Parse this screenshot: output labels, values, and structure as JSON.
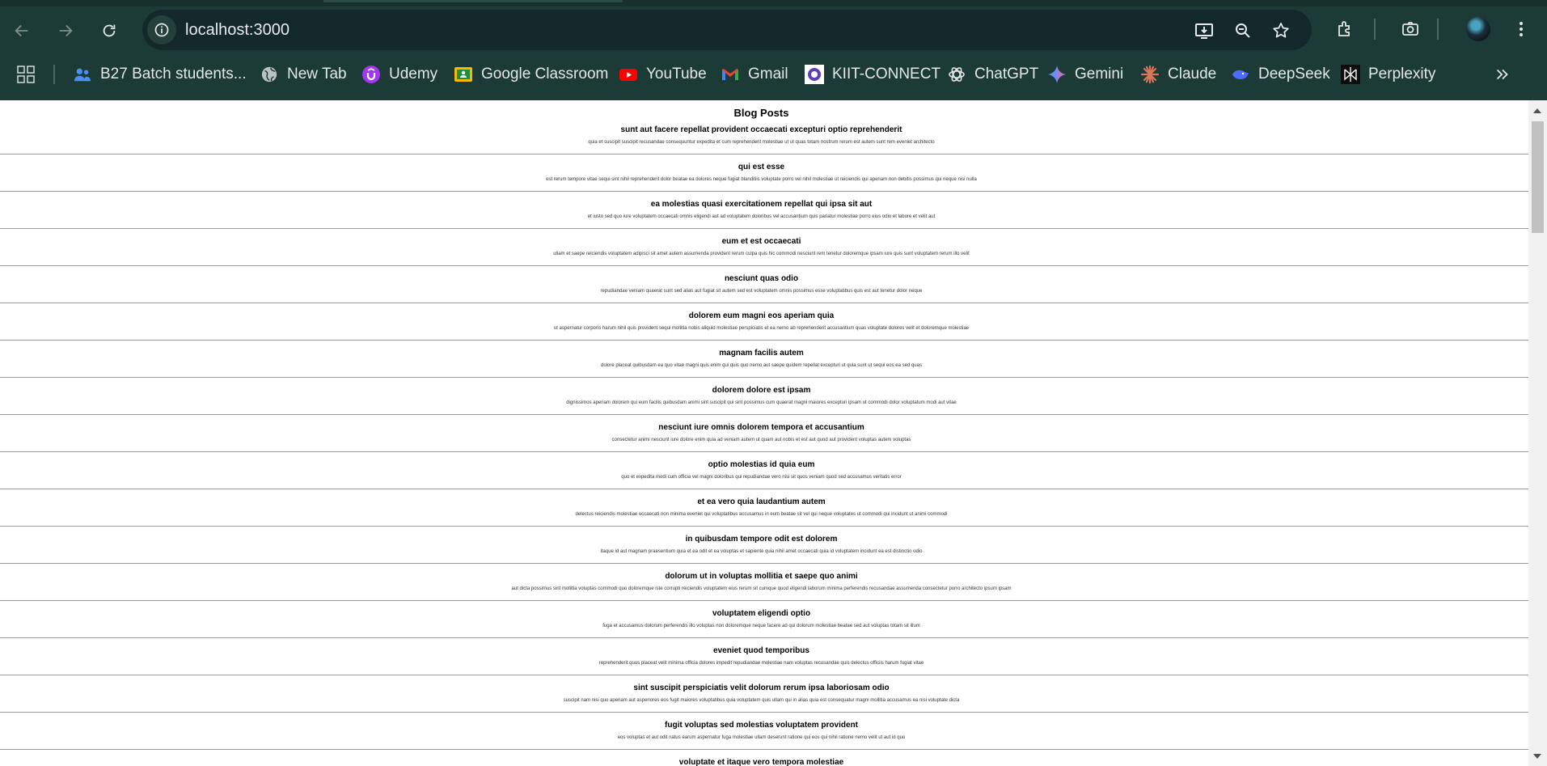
{
  "browser": {
    "url": "localhost:3000",
    "bookmarks": [
      {
        "label": "B27 Batch students...",
        "icon": "people-icon"
      },
      {
        "label": "New Tab",
        "icon": "globe-icon"
      },
      {
        "label": "Udemy",
        "icon": "udemy-icon"
      },
      {
        "label": "Google Classroom",
        "icon": "classroom-icon"
      },
      {
        "label": "YouTube",
        "icon": "youtube-icon"
      },
      {
        "label": "Gmail",
        "icon": "gmail-icon"
      },
      {
        "label": "KIIT-CONNECT",
        "icon": "kiit-icon"
      },
      {
        "label": "ChatGPT",
        "icon": "chatgpt-icon"
      },
      {
        "label": "Gemini",
        "icon": "gemini-icon"
      },
      {
        "label": "Claude",
        "icon": "claude-icon"
      },
      {
        "label": "DeepSeek",
        "icon": "deepseek-icon"
      },
      {
        "label": "Perplexity",
        "icon": "perplexity-icon"
      }
    ]
  },
  "page": {
    "title": "Blog Posts",
    "posts": [
      {
        "title": "sunt aut facere repellat provident occaecati excepturi optio reprehenderit",
        "body": "quia et suscipit suscipit recusandae consequuntur expedita et cum reprehenderit molestiae ut ut quas totam nostrum rerum est autem sunt rem eveniet architecto"
      },
      {
        "title": "qui est esse",
        "body": "est rerum tempore vitae sequi sint nihil reprehenderit dolor beatae ea dolores neque fugiat blanditiis voluptate porro vel nihil molestiae ut reiciendis qui aperiam non debitis possimus qui neque nisi nulla"
      },
      {
        "title": "ea molestias quasi exercitationem repellat qui ipsa sit aut",
        "body": "et iusto sed quo iure voluptatem occaecati omnis eligendi aut ad voluptatem doloribus vel accusantium quis pariatur molestiae porro eius odio et labore et velit aut"
      },
      {
        "title": "eum et est occaecati",
        "body": "ullam et saepe reiciendis voluptatem adipisci sit amet autem assumenda provident rerum culpa quis hic commodi nesciunt rem tenetur doloremque ipsam iure quis sunt voluptatem rerum illo velit"
      },
      {
        "title": "nesciunt quas odio",
        "body": "repudiandae veniam quaerat sunt sed alias aut fugiat sit autem sed est voluptatem omnis possimus esse voluptatibus quis est aut tenetur dolor neque"
      },
      {
        "title": "dolorem eum magni eos aperiam quia",
        "body": "ut aspernatur corporis harum nihil quis provident sequi mollitia nobis aliquid molestiae perspiciatis et ea nemo ab reprehenderit accusantium quas voluptate dolores velit et doloremque molestiae"
      },
      {
        "title": "magnam facilis autem",
        "body": "dolore placeat quibusdam ea quo vitae magni quis enim qui quis quo nemo aut saepe quidem repellat excepturi ut quia sunt ut sequi eos ea sed quas"
      },
      {
        "title": "dolorem dolore est ipsam",
        "body": "dignissimos aperiam dolorem qui eum facilis quibusdam animi sint suscipit qui sint possimus cum quaerat magni maiores excepturi ipsam ut commodi dolor voluptatum modi aut vitae"
      },
      {
        "title": "nesciunt iure omnis dolorem tempora et accusantium",
        "body": "consectetur animi nesciunt iure dolore enim quia ad veniam autem ut quam aut nobis et est aut quod aut provident voluptas autem voluptas"
      },
      {
        "title": "optio molestias id quia eum",
        "body": "quo et expedita modi cum officia vel magni doloribus qui repudiandae vero nisi sit quos veniam quod sed accusamus veritatis error"
      },
      {
        "title": "et ea vero quia laudantium autem",
        "body": "delectus reiciendis molestiae occaecati non minima eveniet qui voluptatibus accusamus in eum beatae sit vel qui neque voluptates ut commodi qui incidunt ut animi commodi"
      },
      {
        "title": "in quibusdam tempore odit est dolorem",
        "body": "itaque id aut magnam praesentium quia et ea odit et ea voluptas et sapiente quia nihil amet occaecati quia id voluptatem incidunt ea est distinctio odio"
      },
      {
        "title": "dolorum ut in voluptas mollitia et saepe quo animi",
        "body": "aut dicta possimus sint mollitia voluptas commodi quo doloremque iste corrupti reiciendis voluptatem eius rerum sit cumque quod eligendi laborum minima perferendis recusandae assumenda consectetur porro architecto ipsum ipsam"
      },
      {
        "title": "voluptatem eligendi optio",
        "body": "fuga et accusamus dolorum perferendis illo voluptas non doloremque neque facere ad qui dolorum molestiae beatae sed aut voluptas totam sit illum"
      },
      {
        "title": "eveniet quod temporibus",
        "body": "reprehenderit quos placeat velit minima officia dolores impedit repudiandae molestiae nam voluptas recusandae quis delectus officiis harum fugiat vitae"
      },
      {
        "title": "sint suscipit perspiciatis velit dolorum rerum ipsa laboriosam odio",
        "body": "suscipit nam nisi quo aperiam aut asperiores eos fugit maiores voluptatibus quia voluptatem quis ullam qui in alias quia est consequatur magni mollitia accusamus ea nisi voluptate dicta"
      },
      {
        "title": "fugit voluptas sed molestias voluptatem provident",
        "body": "eos voluptas et aut odit natus earum aspernatur fuga molestiae ullam deserunt ratione qui eos qui nihil ratione nemo velit ut aut id quo"
      },
      {
        "title": "voluptate et itaque vero tempora molestiae",
        "body": ""
      }
    ]
  }
}
